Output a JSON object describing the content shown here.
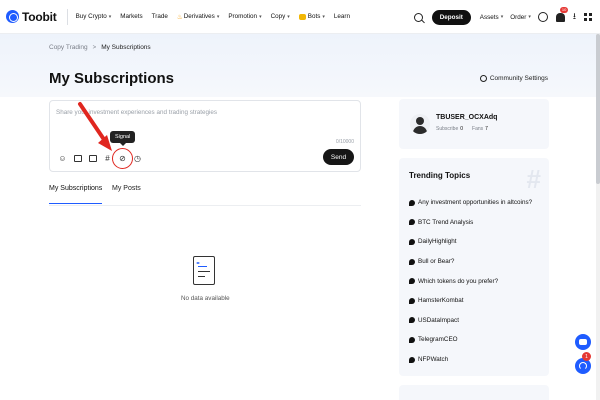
{
  "nav": {
    "brand": "Toobit",
    "items": [
      {
        "label": "Buy Crypto",
        "caret": true
      },
      {
        "label": "Markets",
        "caret": false
      },
      {
        "label": "Trade",
        "caret": false
      },
      {
        "label": "Derivatives",
        "caret": true
      },
      {
        "label": "Promotion",
        "caret": true
      },
      {
        "label": "Copy",
        "caret": true
      },
      {
        "label": "Bots",
        "caret": true
      },
      {
        "label": "Learn",
        "caret": false
      }
    ],
    "deposit_label": "Deposit",
    "assets_label": "Assets",
    "order_label": "Order",
    "bell_badge": "10"
  },
  "breadcrumb": {
    "parent": "Copy Trading",
    "separator": ">",
    "current": "My Subscriptions"
  },
  "page_title": "My Subscriptions",
  "community_settings": "Community Settings",
  "composer": {
    "placeholder": "Share your investment experiences and trading strategies",
    "counter": "0/10000",
    "tooltip": "Signal",
    "send_label": "Send",
    "tools": [
      "emoji-icon",
      "image-icon",
      "video-icon",
      "hashtag-icon",
      "signal-icon",
      "history-icon"
    ]
  },
  "tabs": [
    {
      "label": "My Subscriptions",
      "active": true
    },
    {
      "label": "My Posts",
      "active": false
    }
  ],
  "empty_text": "No data available",
  "user": {
    "username": "TBUSER_OCXAdq",
    "subscribe_label": "Subscribe",
    "subscribe_count": "0",
    "fans_label": "Fans",
    "fans_count": "7"
  },
  "trending": {
    "title": "Trending Topics",
    "items": [
      "Any investment opportunities in altcoins?",
      "BTC Trend Analysis",
      "DailyHighlight",
      "Bull or Bear?",
      "Which tokens do you prefer?",
      "HamsterKombat",
      "USDataImpact",
      "TelegramCEO",
      "NFPWatch"
    ]
  },
  "support_badge": "1",
  "colors": {
    "accent": "#1f5cff",
    "annotation": "#e0261f",
    "dark": "#161616"
  }
}
